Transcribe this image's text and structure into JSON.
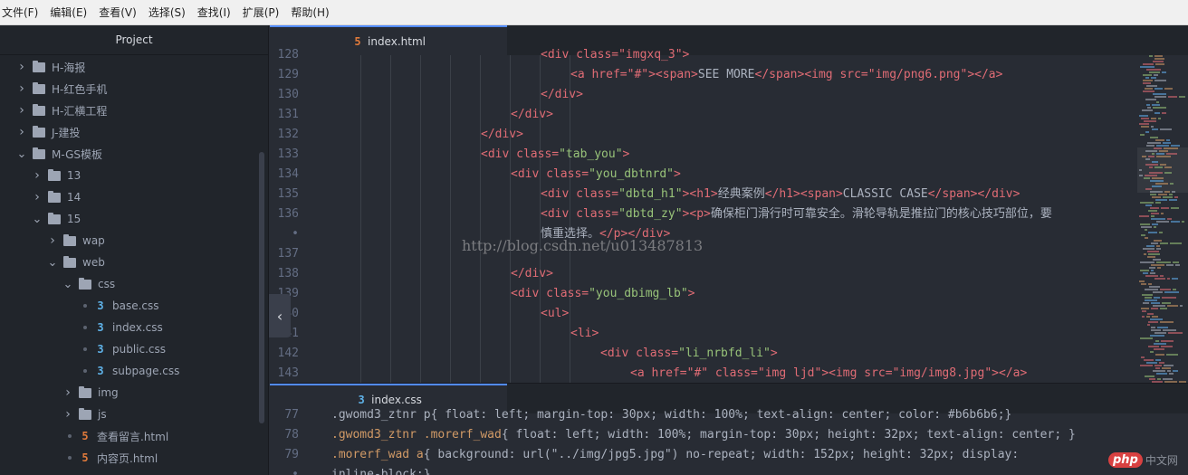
{
  "menubar": {
    "items": [
      "文件(F)",
      "编辑(E)",
      "查看(V)",
      "选择(S)",
      "查找(I)",
      "扩展(P)",
      "帮助(H)"
    ]
  },
  "sidebar": {
    "title": "Project",
    "tree": [
      {
        "label": "H-海报",
        "type": "folder",
        "expanded": false
      },
      {
        "label": "H-红色手机",
        "type": "folder",
        "expanded": false
      },
      {
        "label": "H-汇横工程",
        "type": "folder",
        "expanded": false
      },
      {
        "label": "J-建投",
        "type": "folder",
        "expanded": false
      },
      {
        "label": "M-GS模板",
        "type": "folder",
        "expanded": true
      },
      {
        "label": "13",
        "type": "folder",
        "expanded": false
      },
      {
        "label": "14",
        "type": "folder",
        "expanded": false
      },
      {
        "label": "15",
        "type": "folder",
        "expanded": true
      },
      {
        "label": "wap",
        "type": "folder",
        "expanded": false
      },
      {
        "label": "web",
        "type": "folder",
        "expanded": true
      },
      {
        "label": "css",
        "type": "folder",
        "expanded": true
      },
      {
        "label": "base.css",
        "type": "css"
      },
      {
        "label": "index.css",
        "type": "css"
      },
      {
        "label": "public.css",
        "type": "css"
      },
      {
        "label": "subpage.css",
        "type": "css"
      },
      {
        "label": "img",
        "type": "folder",
        "expanded": false
      },
      {
        "label": "js",
        "type": "folder",
        "expanded": false
      },
      {
        "label": "查看留言.html",
        "type": "html"
      },
      {
        "label": "内容页.html",
        "type": "html"
      }
    ]
  },
  "pane1": {
    "tab_label": "index.html",
    "line_numbers": [
      "128",
      "129",
      "130",
      "131",
      "132",
      "133",
      "134",
      "135",
      "136",
      "•",
      "137",
      "138",
      "139",
      "140",
      "141",
      "142",
      "143"
    ],
    "code": {
      "l128": "<div class=\"imgxq_3\">",
      "l129_a": "<a href=\"#\">",
      "l129_span_open": "<span>",
      "l129_text": "SEE MORE",
      "l129_span_close": "</span>",
      "l129_img": "<img src=\"img/png6.png\">",
      "l129_a_close": "</a>",
      "l130": "</div>",
      "l131": "</div>",
      "l132": "</div>",
      "l133_open": "<div class=",
      "l133_str": "\"tab_you\"",
      "l133_close": ">",
      "l134_open": "<div class=",
      "l134_str": "\"you_dbtnrd\"",
      "l134_close": ">",
      "l135_open": "<div class=",
      "l135_str": "\"dbtd_h1\"",
      "l135_h1": "><h1>",
      "l135_text": "经典案例",
      "l135_h1c": "</h1><span>",
      "l135_text2": "CLASSIC CASE",
      "l135_end": "</span></div>",
      "l136_open": "<div class=",
      "l136_str": "\"dbtd_zy\"",
      "l136_p": "><p>",
      "l136_text": "确保柜门滑行时可靠安全。滑轮导轨是推拉门的核心技巧部位，要",
      "l136b_text": "慎重选择。",
      "l136b_end": "</p></div>",
      "l138": "</div>",
      "l139_open": "<div class=",
      "l139_str": "\"you_dbimg_lb\"",
      "l139_close": ">",
      "l140": "<ul>",
      "l141": "<li>",
      "l142_open": "<div class=",
      "l142_str": "\"li_nrbfd_li\"",
      "l142_close": ">",
      "l143": "<a href=\"#\" class=\"img ljd\"><img src=\"img/img8.jpg\"></a>"
    },
    "watermark": "http://blog.csdn.net/u013487813"
  },
  "pane2": {
    "tab_label": "index.css",
    "line_numbers": [
      "77",
      "78",
      "79",
      "•"
    ],
    "code": {
      "l77": ".gwomd3_ztnr p{ float: left; margin-top: 30px; width: 100%; text-align: center; color: #b6b6b6;}",
      "l78_sel": ".gwomd3_ztnr .morerf_wad",
      "l78_rest": "{ float: left; width: 100%; margin-top: 30px; height: 32px; text-align: center; }",
      "l79_sel": ".morerf_wad a",
      "l79_rest": "{ background: url(\"../img/jpg5.jpg\") no-repeat; width: 152px; height: 32px; display:",
      "l79b": "inline-block;}"
    }
  },
  "badge": {
    "brand": "php",
    "site": "中文网"
  },
  "colors": {
    "accent": "#528bff",
    "background": "#282c34",
    "sidebar": "#21252b"
  }
}
